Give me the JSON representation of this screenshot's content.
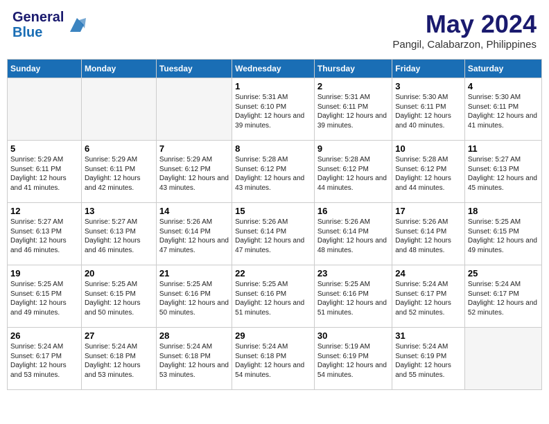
{
  "header": {
    "logo_line1": "General",
    "logo_line2": "Blue",
    "title": "May 2024",
    "subtitle": "Pangil, Calabarzon, Philippines"
  },
  "columns": [
    "Sunday",
    "Monday",
    "Tuesday",
    "Wednesday",
    "Thursday",
    "Friday",
    "Saturday"
  ],
  "weeks": [
    [
      {
        "day": "",
        "sunrise": "",
        "sunset": "",
        "daylight": "",
        "empty": true
      },
      {
        "day": "",
        "sunrise": "",
        "sunset": "",
        "daylight": "",
        "empty": true
      },
      {
        "day": "",
        "sunrise": "",
        "sunset": "",
        "daylight": "",
        "empty": true
      },
      {
        "day": "1",
        "sunrise": "Sunrise: 5:31 AM",
        "sunset": "Sunset: 6:10 PM",
        "daylight": "Daylight: 12 hours and 39 minutes.",
        "empty": false
      },
      {
        "day": "2",
        "sunrise": "Sunrise: 5:31 AM",
        "sunset": "Sunset: 6:11 PM",
        "daylight": "Daylight: 12 hours and 39 minutes.",
        "empty": false
      },
      {
        "day": "3",
        "sunrise": "Sunrise: 5:30 AM",
        "sunset": "Sunset: 6:11 PM",
        "daylight": "Daylight: 12 hours and 40 minutes.",
        "empty": false
      },
      {
        "day": "4",
        "sunrise": "Sunrise: 5:30 AM",
        "sunset": "Sunset: 6:11 PM",
        "daylight": "Daylight: 12 hours and 41 minutes.",
        "empty": false
      }
    ],
    [
      {
        "day": "5",
        "sunrise": "Sunrise: 5:29 AM",
        "sunset": "Sunset: 6:11 PM",
        "daylight": "Daylight: 12 hours and 41 minutes.",
        "empty": false
      },
      {
        "day": "6",
        "sunrise": "Sunrise: 5:29 AM",
        "sunset": "Sunset: 6:11 PM",
        "daylight": "Daylight: 12 hours and 42 minutes.",
        "empty": false
      },
      {
        "day": "7",
        "sunrise": "Sunrise: 5:29 AM",
        "sunset": "Sunset: 6:12 PM",
        "daylight": "Daylight: 12 hours and 43 minutes.",
        "empty": false
      },
      {
        "day": "8",
        "sunrise": "Sunrise: 5:28 AM",
        "sunset": "Sunset: 6:12 PM",
        "daylight": "Daylight: 12 hours and 43 minutes.",
        "empty": false
      },
      {
        "day": "9",
        "sunrise": "Sunrise: 5:28 AM",
        "sunset": "Sunset: 6:12 PM",
        "daylight": "Daylight: 12 hours and 44 minutes.",
        "empty": false
      },
      {
        "day": "10",
        "sunrise": "Sunrise: 5:28 AM",
        "sunset": "Sunset: 6:12 PM",
        "daylight": "Daylight: 12 hours and 44 minutes.",
        "empty": false
      },
      {
        "day": "11",
        "sunrise": "Sunrise: 5:27 AM",
        "sunset": "Sunset: 6:13 PM",
        "daylight": "Daylight: 12 hours and 45 minutes.",
        "empty": false
      }
    ],
    [
      {
        "day": "12",
        "sunrise": "Sunrise: 5:27 AM",
        "sunset": "Sunset: 6:13 PM",
        "daylight": "Daylight: 12 hours and 46 minutes.",
        "empty": false
      },
      {
        "day": "13",
        "sunrise": "Sunrise: 5:27 AM",
        "sunset": "Sunset: 6:13 PM",
        "daylight": "Daylight: 12 hours and 46 minutes.",
        "empty": false
      },
      {
        "day": "14",
        "sunrise": "Sunrise: 5:26 AM",
        "sunset": "Sunset: 6:14 PM",
        "daylight": "Daylight: 12 hours and 47 minutes.",
        "empty": false
      },
      {
        "day": "15",
        "sunrise": "Sunrise: 5:26 AM",
        "sunset": "Sunset: 6:14 PM",
        "daylight": "Daylight: 12 hours and 47 minutes.",
        "empty": false
      },
      {
        "day": "16",
        "sunrise": "Sunrise: 5:26 AM",
        "sunset": "Sunset: 6:14 PM",
        "daylight": "Daylight: 12 hours and 48 minutes.",
        "empty": false
      },
      {
        "day": "17",
        "sunrise": "Sunrise: 5:26 AM",
        "sunset": "Sunset: 6:14 PM",
        "daylight": "Daylight: 12 hours and 48 minutes.",
        "empty": false
      },
      {
        "day": "18",
        "sunrise": "Sunrise: 5:25 AM",
        "sunset": "Sunset: 6:15 PM",
        "daylight": "Daylight: 12 hours and 49 minutes.",
        "empty": false
      }
    ],
    [
      {
        "day": "19",
        "sunrise": "Sunrise: 5:25 AM",
        "sunset": "Sunset: 6:15 PM",
        "daylight": "Daylight: 12 hours and 49 minutes.",
        "empty": false
      },
      {
        "day": "20",
        "sunrise": "Sunrise: 5:25 AM",
        "sunset": "Sunset: 6:15 PM",
        "daylight": "Daylight: 12 hours and 50 minutes.",
        "empty": false
      },
      {
        "day": "21",
        "sunrise": "Sunrise: 5:25 AM",
        "sunset": "Sunset: 6:16 PM",
        "daylight": "Daylight: 12 hours and 50 minutes.",
        "empty": false
      },
      {
        "day": "22",
        "sunrise": "Sunrise: 5:25 AM",
        "sunset": "Sunset: 6:16 PM",
        "daylight": "Daylight: 12 hours and 51 minutes.",
        "empty": false
      },
      {
        "day": "23",
        "sunrise": "Sunrise: 5:25 AM",
        "sunset": "Sunset: 6:16 PM",
        "daylight": "Daylight: 12 hours and 51 minutes.",
        "empty": false
      },
      {
        "day": "24",
        "sunrise": "Sunrise: 5:24 AM",
        "sunset": "Sunset: 6:17 PM",
        "daylight": "Daylight: 12 hours and 52 minutes.",
        "empty": false
      },
      {
        "day": "25",
        "sunrise": "Sunrise: 5:24 AM",
        "sunset": "Sunset: 6:17 PM",
        "daylight": "Daylight: 12 hours and 52 minutes.",
        "empty": false
      }
    ],
    [
      {
        "day": "26",
        "sunrise": "Sunrise: 5:24 AM",
        "sunset": "Sunset: 6:17 PM",
        "daylight": "Daylight: 12 hours and 53 minutes.",
        "empty": false
      },
      {
        "day": "27",
        "sunrise": "Sunrise: 5:24 AM",
        "sunset": "Sunset: 6:18 PM",
        "daylight": "Daylight: 12 hours and 53 minutes.",
        "empty": false
      },
      {
        "day": "28",
        "sunrise": "Sunrise: 5:24 AM",
        "sunset": "Sunset: 6:18 PM",
        "daylight": "Daylight: 12 hours and 53 minutes.",
        "empty": false
      },
      {
        "day": "29",
        "sunrise": "Sunrise: 5:24 AM",
        "sunset": "Sunset: 6:18 PM",
        "daylight": "Daylight: 12 hours and 54 minutes.",
        "empty": false
      },
      {
        "day": "30",
        "sunrise": "Sunrise: 5:19 AM",
        "sunset": "Sunset: 6:19 PM",
        "daylight": "Daylight: 12 hours and 54 minutes.",
        "empty": false
      },
      {
        "day": "31",
        "sunrise": "Sunrise: 5:24 AM",
        "sunset": "Sunset: 6:19 PM",
        "daylight": "Daylight: 12 hours and 55 minutes.",
        "empty": false
      },
      {
        "day": "",
        "sunrise": "",
        "sunset": "",
        "daylight": "",
        "empty": true
      }
    ]
  ]
}
